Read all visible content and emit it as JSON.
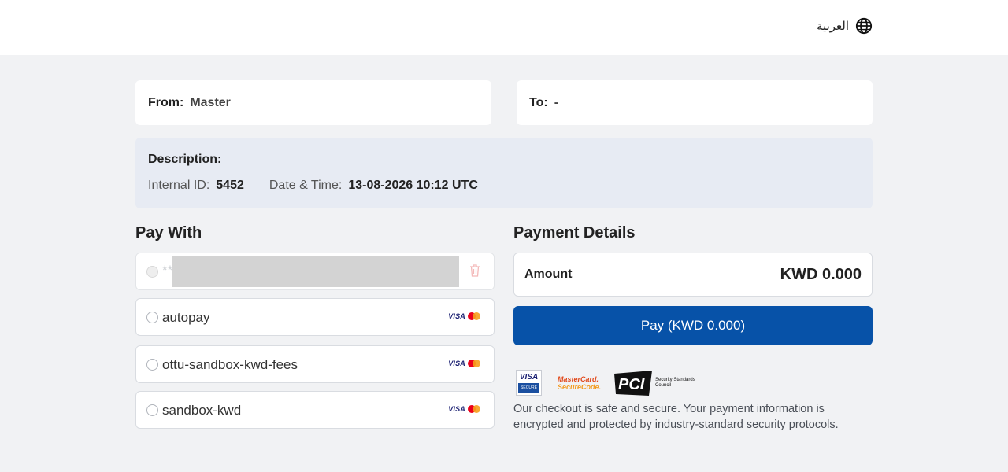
{
  "header": {
    "language_label": "العربية",
    "language_icon": "globe-icon"
  },
  "transfer": {
    "from_label": "From:",
    "from_value": "Master",
    "to_label": "To:",
    "to_value": "-"
  },
  "description": {
    "title": "Description:",
    "internal_id_label": "Internal ID:",
    "internal_id_value": "5452",
    "datetime_label": "Date & Time:",
    "datetime_value": "13-08-2026 10:12 UTC"
  },
  "pay_with": {
    "title": "Pay With",
    "saved_card_masked": "**",
    "methods": [
      {
        "label": "autopay",
        "brands": "VISA"
      },
      {
        "label": "ottu-sandbox-kwd-fees",
        "brands": "VISA"
      },
      {
        "label": "sandbox-kwd",
        "brands": "VISA"
      }
    ]
  },
  "payment_details": {
    "title": "Payment Details",
    "amount_label": "Amount",
    "amount_value": "KWD 0.000",
    "pay_button_label": "Pay (KWD 0.000)"
  },
  "security": {
    "visa_badge_top": "VISA",
    "visa_badge_bottom": "SECURE",
    "mastercard_line1": "MasterCard.",
    "mastercard_line2": "SecureCode.",
    "pci_text": "Security Standards Council",
    "message": "Our checkout is safe and secure. Your payment information is encrypted and protected by industry-standard security protocols."
  },
  "colors": {
    "primary_button": "#0752a8",
    "background": "#f1f2f4",
    "description_bg": "#e7ebf3"
  }
}
